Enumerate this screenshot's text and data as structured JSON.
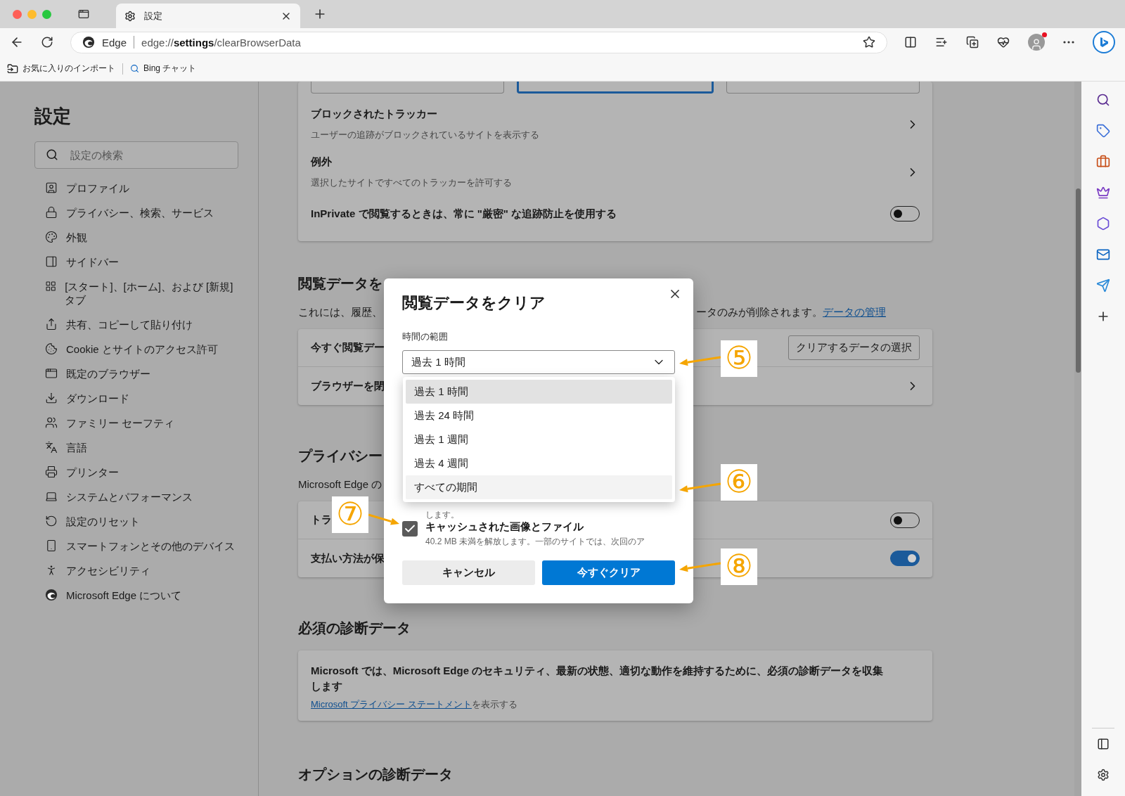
{
  "window": {
    "tab_title": "設定"
  },
  "address_bar": {
    "site_label": "Edge",
    "url": "edge://**settings**/clearBrowserData"
  },
  "favorites_bar": [
    {
      "kind": "import",
      "label": "お気に入りのインポート"
    },
    {
      "kind": "search",
      "label": "Bing チャット"
    }
  ],
  "nav": {
    "title": "設定",
    "search_placeholder": "設定の検索",
    "items": [
      {
        "label": "プロファイル"
      },
      {
        "label": "プライバシー、検索、サービス"
      },
      {
        "label": "外観"
      },
      {
        "label": "サイドバー"
      },
      {
        "label": "[スタート]、[ホーム]、および [新規] タブ"
      },
      {
        "label": "共有、コピーして貼り付け"
      },
      {
        "label": "Cookie とサイトのアクセス許可"
      },
      {
        "label": "既定のブラウザー"
      },
      {
        "label": "ダウンロード"
      },
      {
        "label": "ファミリー セーフティ"
      },
      {
        "label": "言語"
      },
      {
        "label": "プリンター"
      },
      {
        "label": "システムとパフォーマンス"
      },
      {
        "label": "設定のリセット"
      },
      {
        "label": "スマートフォンとその他のデバイス"
      },
      {
        "label": "アクセシビリティ"
      },
      {
        "label": "Microsoft Edge について"
      }
    ]
  },
  "tracking_card": {
    "option_boxes": [
      {
        "selected": false
      },
      {
        "selected": true
      },
      {
        "selected": false
      }
    ],
    "links": [
      {
        "title": "ブロックされたトラッカー",
        "subtitle": "ユーザーの追跡がブロックされているサイトを表示する"
      },
      {
        "title": "例外",
        "subtitle": "選択したサイトですべてのトラッカーを許可する"
      }
    ],
    "toggle_row": {
      "label": "InPrivate で閲覧するときは、常に \"厳密\" な追跡防止を使用する",
      "on": false
    }
  },
  "clear_section": {
    "heading": "閲覧データを",
    "description_start": "これには、履歴、",
    "description_end": "ータのみが削除されます。",
    "link": "データの管理",
    "rows": [
      {
        "kind": "button",
        "label": "今すぐ閲覧デー",
        "button": "クリアするデータの選択"
      },
      {
        "kind": "chevron",
        "label": "ブラウザーを閉"
      }
    ]
  },
  "privacy_section": {
    "heading": "プライバシー",
    "description": "Microsoft Edge の",
    "rows": [
      {
        "label": "トラ",
        "on": false
      },
      {
        "label": "支払い方法が保",
        "on": true
      }
    ]
  },
  "diagnostic_section": {
    "heading": "必須の診断データ",
    "text": "Microsoft では、Microsoft Edge のセキュリティ、最新の状態、適切な動作を維持するために、必須の診断データを収集します",
    "link": "Microsoft プライバシー ステートメント",
    "link_suffix": "を表示する"
  },
  "optional_heading": "オプションの診断データ",
  "dialog": {
    "title": "閲覧データをクリア",
    "range_label": "時間の範囲",
    "range_value": "過去 1 時間",
    "options": [
      {
        "label": "過去 1 時間",
        "selected": true,
        "hovered": false
      },
      {
        "label": "過去 24 時間",
        "selected": false,
        "hovered": false
      },
      {
        "label": "過去 1 週間",
        "selected": false,
        "hovered": false
      },
      {
        "label": "過去 4 週間",
        "selected": false,
        "hovered": false
      },
      {
        "label": "すべての期間",
        "selected": false,
        "hovered": true
      }
    ],
    "partial_text": "します。",
    "checkbox": {
      "label": "キャッシュされた画像とファイル",
      "detail": "40.2 MB 未満を解放します。一部のサイトでは、次回のア",
      "checked": true
    },
    "buttons": [
      {
        "kind": "secondary",
        "label": "キャンセル"
      },
      {
        "kind": "primary",
        "label": "今すぐクリア"
      }
    ]
  },
  "annotations": [
    {
      "label": "⑤"
    },
    {
      "label": "⑥"
    },
    {
      "label": "⑦"
    },
    {
      "label": "⑧"
    }
  ]
}
